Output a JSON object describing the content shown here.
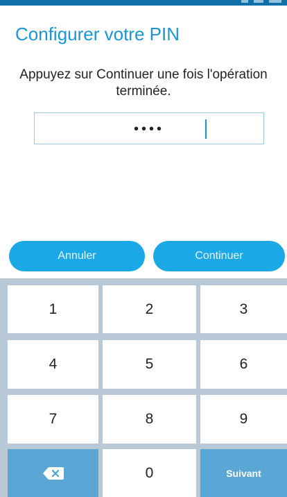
{
  "screen": {
    "title": "Configurer votre PIN",
    "instruction": "Appuyez sur Continuer une fois l'opération terminée."
  },
  "pin_input": {
    "masked_value": "••••"
  },
  "buttons": {
    "cancel_label": "Annuler",
    "continue_label": "Continuer"
  },
  "keypad": {
    "keys": [
      "1",
      "2",
      "3",
      "4",
      "5",
      "6",
      "7",
      "8",
      "9"
    ],
    "zero": "0",
    "next_label": "Suivant",
    "backspace_icon": "backspace-icon"
  },
  "colors": {
    "accent": "#1996d3",
    "button": "#1aa8e6",
    "action_key": "#5aa7d6",
    "keypad_bg": "#b9c8d6"
  }
}
